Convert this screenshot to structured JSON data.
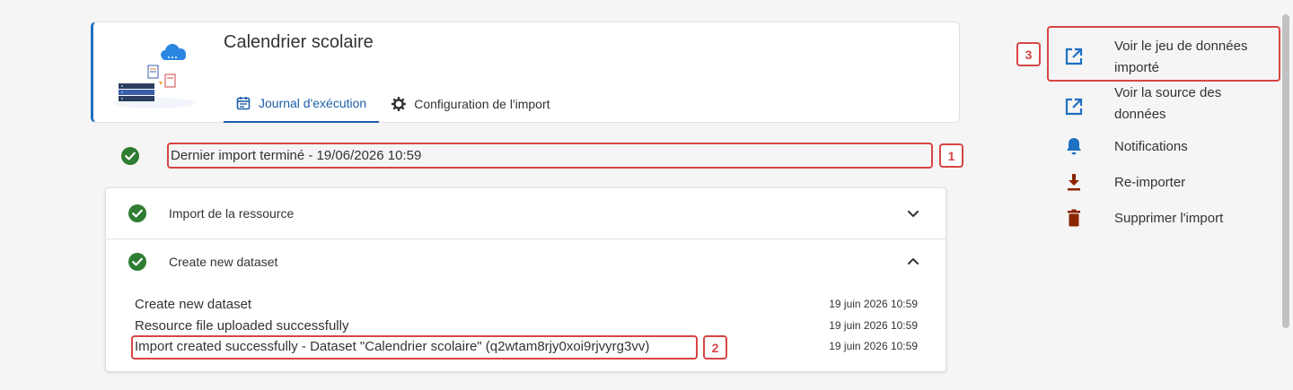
{
  "header": {
    "title": "Calendrier scolaire",
    "tabs": [
      {
        "label": "Journal d'exécution",
        "icon": "calendar-icon",
        "active": true
      },
      {
        "label": "Configuration de l'import",
        "icon": "gear-icon",
        "active": false
      }
    ]
  },
  "status": {
    "text": "Dernier import terminé - 19/06/2026 10:59",
    "marker": "1"
  },
  "steps": [
    {
      "label": "Import de la ressource",
      "expanded": false
    },
    {
      "label": "Create new dataset",
      "expanded": true
    }
  ],
  "log": {
    "lines": [
      {
        "message": "Create new dataset",
        "time": "19 juin 2026 10:59"
      },
      {
        "message": "Resource file uploaded successfully",
        "time": "19 juin 2026 10:59"
      },
      {
        "message": "Import created successfully - Dataset \"Calendrier scolaire\" (q2wtam8rjy0xoi9rjvyrg3vv)",
        "time": "19 juin 2026 10:59"
      }
    ],
    "marker": "2"
  },
  "actions": {
    "marker": "3",
    "items": [
      {
        "label": "Voir le jeu de données importé",
        "icon": "external-link-icon"
      },
      {
        "label": "Voir la source des données",
        "icon": "external-link-icon"
      },
      {
        "label": "Notifications",
        "icon": "bell-icon"
      },
      {
        "label": "Re-importer",
        "icon": "download-icon"
      },
      {
        "label": "Supprimer l'import",
        "icon": "trash-icon"
      }
    ]
  },
  "colors": {
    "accent": "#1e70c1",
    "success": "#2e7d32",
    "danger": "#8b2500",
    "highlight": "#d64545"
  }
}
